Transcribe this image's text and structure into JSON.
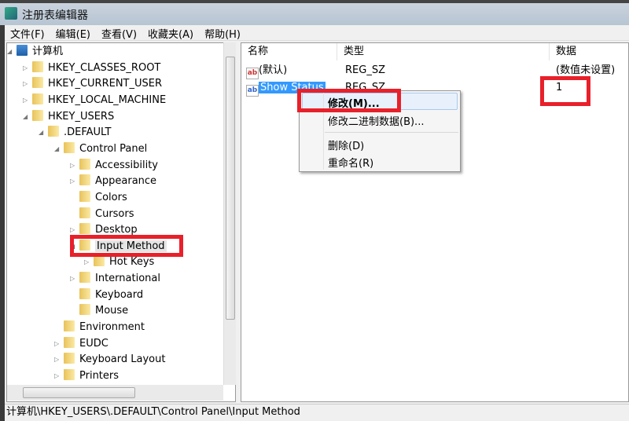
{
  "window": {
    "title": "注册表编辑器"
  },
  "menu": [
    "文件(F)",
    "编辑(E)",
    "查看(V)",
    "收藏夹(A)",
    "帮助(H)"
  ],
  "tree": [
    {
      "label": "计算机",
      "level": 0,
      "expander": "expanded",
      "folder": false
    },
    {
      "label": "HKEY_CLASSES_ROOT",
      "level": 1,
      "expander": "collapsed"
    },
    {
      "label": "HKEY_CURRENT_USER",
      "level": 1,
      "expander": "collapsed"
    },
    {
      "label": "HKEY_LOCAL_MACHINE",
      "level": 1,
      "expander": "collapsed"
    },
    {
      "label": "HKEY_USERS",
      "level": 1,
      "expander": "expanded"
    },
    {
      "label": ".DEFAULT",
      "level": 2,
      "expander": "expanded"
    },
    {
      "label": "Control Panel",
      "level": 3,
      "expander": "expanded"
    },
    {
      "label": "Accessibility",
      "level": 4,
      "expander": "collapsed"
    },
    {
      "label": "Appearance",
      "level": 4,
      "expander": "collapsed"
    },
    {
      "label": "Colors",
      "level": 4,
      "expander": "none"
    },
    {
      "label": "Cursors",
      "level": 4,
      "expander": "none"
    },
    {
      "label": "Desktop",
      "level": 4,
      "expander": "collapsed"
    },
    {
      "label": "Input Method",
      "level": 4,
      "expander": "expanded",
      "selected": true
    },
    {
      "label": "Hot Keys",
      "level": 5,
      "expander": "collapsed"
    },
    {
      "label": "International",
      "level": 4,
      "expander": "collapsed"
    },
    {
      "label": "Keyboard",
      "level": 4,
      "expander": "none"
    },
    {
      "label": "Mouse",
      "level": 4,
      "expander": "none"
    },
    {
      "label": "Environment",
      "level": 3,
      "expander": "none"
    },
    {
      "label": "EUDC",
      "level": 3,
      "expander": "collapsed"
    },
    {
      "label": "Keyboard Layout",
      "level": 3,
      "expander": "collapsed"
    },
    {
      "label": "Printers",
      "level": 3,
      "expander": "collapsed"
    }
  ],
  "list": {
    "columns": [
      "名称",
      "类型",
      "数据"
    ],
    "rows": [
      {
        "name": "(默认)",
        "type": "REG_SZ",
        "data": "(数值未设置)",
        "icon": "ab"
      },
      {
        "name": "Show Status",
        "type": "REG_SZ",
        "data": "1",
        "icon": "ab",
        "selected": true
      }
    ]
  },
  "context_menu": [
    "修改(M)...",
    "修改二进制数据(B)...",
    "删除(D)",
    "重命名(R)"
  ],
  "status": "计算机\\HKEY_USERS\\.DEFAULT\\Control Panel\\Input Method",
  "colors": {
    "highlight": "#e8202a",
    "selection": "#3399ff"
  }
}
